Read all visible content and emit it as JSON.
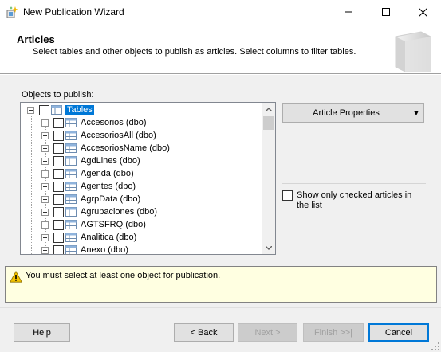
{
  "window": {
    "title": "New Publication Wizard",
    "minimize_icon": "minimize-icon",
    "maximize_icon": "maximize-icon",
    "close_icon": "close-icon"
  },
  "header": {
    "title": "Articles",
    "description": "Select tables and other objects to publish as articles. Select columns to filter tables."
  },
  "objects": {
    "label": "Objects to publish:",
    "root": {
      "label": "Tables",
      "checked": false,
      "selected": true
    },
    "items": [
      {
        "label": "Accesorios (dbo)",
        "checked": false
      },
      {
        "label": "AccesoriosAll (dbo)",
        "checked": false
      },
      {
        "label": "AccesoriosName (dbo)",
        "checked": false
      },
      {
        "label": "AgdLines (dbo)",
        "checked": false
      },
      {
        "label": "Agenda (dbo)",
        "checked": false
      },
      {
        "label": "Agentes (dbo)",
        "checked": false
      },
      {
        "label": "AgrpData (dbo)",
        "checked": false
      },
      {
        "label": "Agrupaciones (dbo)",
        "checked": false
      },
      {
        "label": "AGTSFRQ (dbo)",
        "checked": false
      },
      {
        "label": "Analitica (dbo)",
        "checked": false
      },
      {
        "label": "Anexo (dbo)",
        "checked": false
      }
    ]
  },
  "article_properties": {
    "label": "Article Properties",
    "arrow": "▼"
  },
  "show_only_checked": {
    "label": "Show only checked articles in the list",
    "checked": false
  },
  "message": {
    "text": "You must select at least one object for publication.",
    "icon": "warning-icon"
  },
  "buttons": {
    "help": "Help",
    "back": "< Back",
    "next": "Next >",
    "finish": "Finish >>|",
    "cancel": "Cancel"
  },
  "colors": {
    "selection": "#0078d7",
    "message_bg": "#ffffe1",
    "warning": "#f5c400"
  }
}
